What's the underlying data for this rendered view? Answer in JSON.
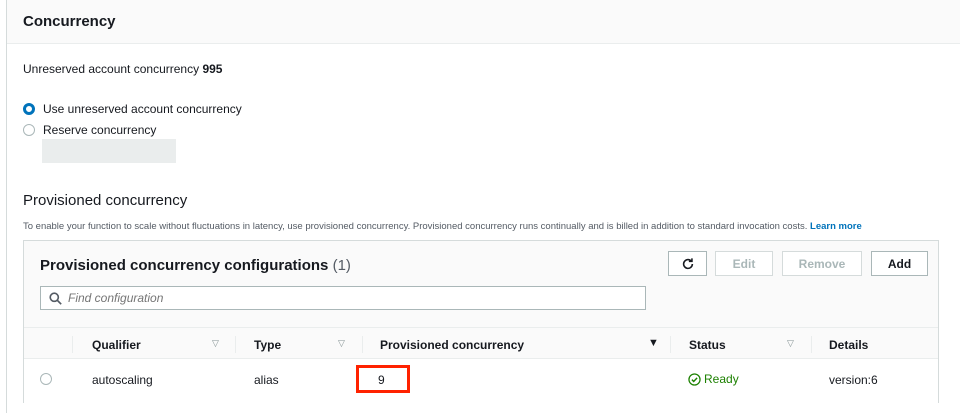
{
  "panel": {
    "title": "Concurrency"
  },
  "unreserved": {
    "label": "Unreserved account concurrency",
    "value": "995"
  },
  "radios": {
    "use_unreserved": "Use unreserved account concurrency",
    "reserve": "Reserve concurrency",
    "selected": "use_unreserved"
  },
  "provisioned": {
    "title": "Provisioned concurrency",
    "description": "To enable your function to scale without fluctuations in latency, use provisioned concurrency. Provisioned concurrency runs continually and is billed in addition to standard invocation costs.",
    "learn_more": "Learn more"
  },
  "table": {
    "title": "Provisioned concurrency configurations",
    "count": "(1)",
    "buttons": {
      "edit": "Edit",
      "remove": "Remove",
      "add": "Add"
    },
    "search_placeholder": "Find configuration",
    "columns": [
      "Qualifier",
      "Type",
      "Provisioned concurrency",
      "Status",
      "Details"
    ],
    "rows": [
      {
        "qualifier": "autoscaling",
        "type": "alias",
        "provisioned": "9",
        "status": "Ready",
        "details": "version:6"
      }
    ]
  },
  "colors": {
    "accent": "#0073bb",
    "success": "#1d8102",
    "highlight": "#ff2200"
  }
}
